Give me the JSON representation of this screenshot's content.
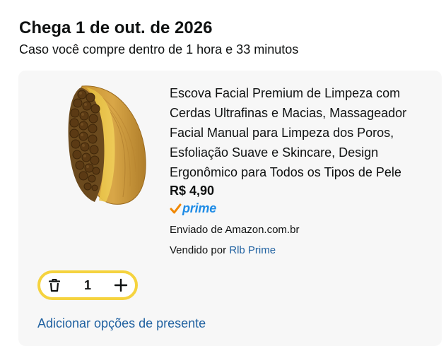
{
  "delivery": {
    "title": "Chega 1 de out. de 2026",
    "subtitle": "Caso você compre dentro de 1 hora e 33 minutos"
  },
  "item": {
    "title": "Escova Facial Premium de Limpeza com Cerdas Ultrafinas e Macias, Massageador Facial Manual para Limpeza dos Poros, Esfoliação Suave e Skincare, Design Ergonômico para Todos os Tipos de Pele",
    "price": "R$ 4,90",
    "prime_label": "prime",
    "shipped_by": "Enviado de Amazon.com.br",
    "sold_by_prefix": "Vendido por",
    "seller": "Rlb Prime",
    "image_icon": "wooden-facial-brush-image"
  },
  "quantity": {
    "value": "1",
    "delete_icon": "trash-icon",
    "increase_icon": "plus-icon"
  },
  "gift": {
    "label": "Adicionar opções de presente"
  },
  "colors": {
    "link": "#2162a1",
    "prime_blue": "#1f8ce6",
    "prime_check": "#f08804",
    "stepper_border": "#f5d33f",
    "card_bg": "#f7f7f7"
  }
}
